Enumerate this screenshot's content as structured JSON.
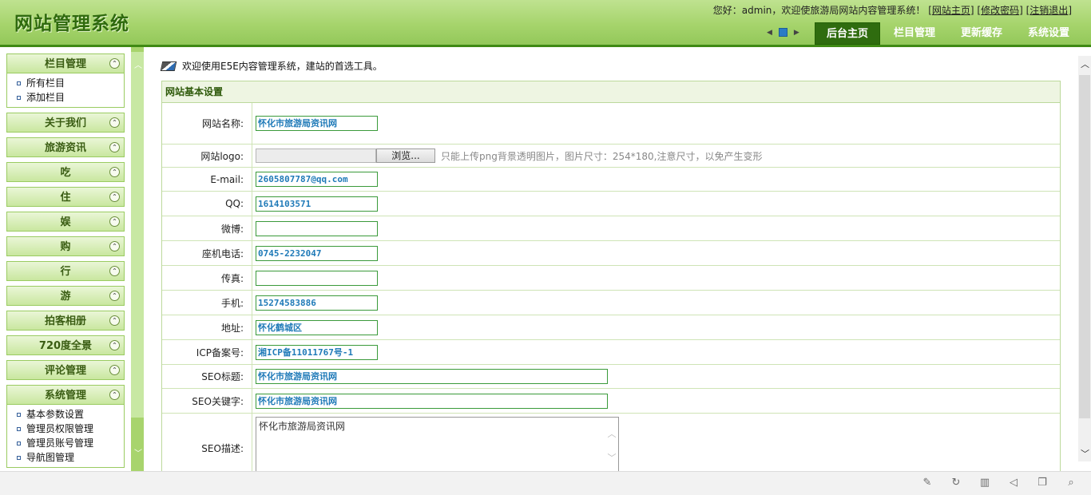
{
  "header": {
    "title": "网站管理系统",
    "welcome_text": "您好：admin，欢迎使旅游局网站内容管理系统！",
    "links": [
      "网站主页",
      "修改密码",
      "注销退出"
    ],
    "tabs": [
      {
        "label": "后台主页",
        "active": true
      },
      {
        "label": "栏目管理",
        "active": false
      },
      {
        "label": "更新缓存",
        "active": false
      },
      {
        "label": "系统设置",
        "active": false
      }
    ]
  },
  "sidebar": {
    "menus": [
      {
        "label": "栏目管理",
        "items": [
          "所有栏目",
          "添加栏目"
        ]
      },
      {
        "label": "关于我们"
      },
      {
        "label": "旅游资讯"
      },
      {
        "label": "吃"
      },
      {
        "label": "住"
      },
      {
        "label": "娱"
      },
      {
        "label": "购"
      },
      {
        "label": "行"
      },
      {
        "label": "游"
      },
      {
        "label": "拍客相册"
      },
      {
        "label": "720度全景"
      },
      {
        "label": "评论管理"
      },
      {
        "label": "系统管理",
        "items": [
          "基本参数设置",
          "管理员权限管理",
          "管理员账号管理",
          "导航图管理"
        ]
      }
    ]
  },
  "main": {
    "intro": "欢迎使用E5E内容管理系统，建站的首选工具。",
    "panel_title": "网站基本设置",
    "fields": [
      {
        "label": "网站名称:",
        "value": "怀化市旅游局资讯网"
      },
      {
        "label": "网站logo:",
        "browse": "浏览...",
        "hint": "只能上传png背景透明图片，图片尺寸：254*180,注意尺寸，以免产生变形"
      },
      {
        "label": "E-mail:",
        "value": "2605807787@qq.com"
      },
      {
        "label": "QQ:",
        "value": "1614103571"
      },
      {
        "label": "微博:",
        "value": ""
      },
      {
        "label": "座机电话:",
        "value": "0745-2232047"
      },
      {
        "label": "传真:",
        "value": ""
      },
      {
        "label": "手机:",
        "value": "15274583886"
      },
      {
        "label": "地址:",
        "value": "怀化鹤城区"
      },
      {
        "label": "ICP备案号:",
        "value": "湘ICP备11011767号-1"
      },
      {
        "label": "SEO标题:",
        "value": "怀化市旅游局资讯网"
      },
      {
        "label": "SEO关键字:",
        "value": "怀化市旅游局资讯网"
      },
      {
        "label": "SEO描述:",
        "value": "怀化市旅游局资讯网"
      }
    ]
  },
  "bottom_icons": [
    "pin-icon",
    "refresh-icon",
    "trash-icon",
    "speaker-icon",
    "window-icon",
    "search-icon"
  ],
  "colors": {
    "accent": "#3f8a14",
    "header_light": "#bfe290",
    "input_text": "#1f7ab8"
  }
}
